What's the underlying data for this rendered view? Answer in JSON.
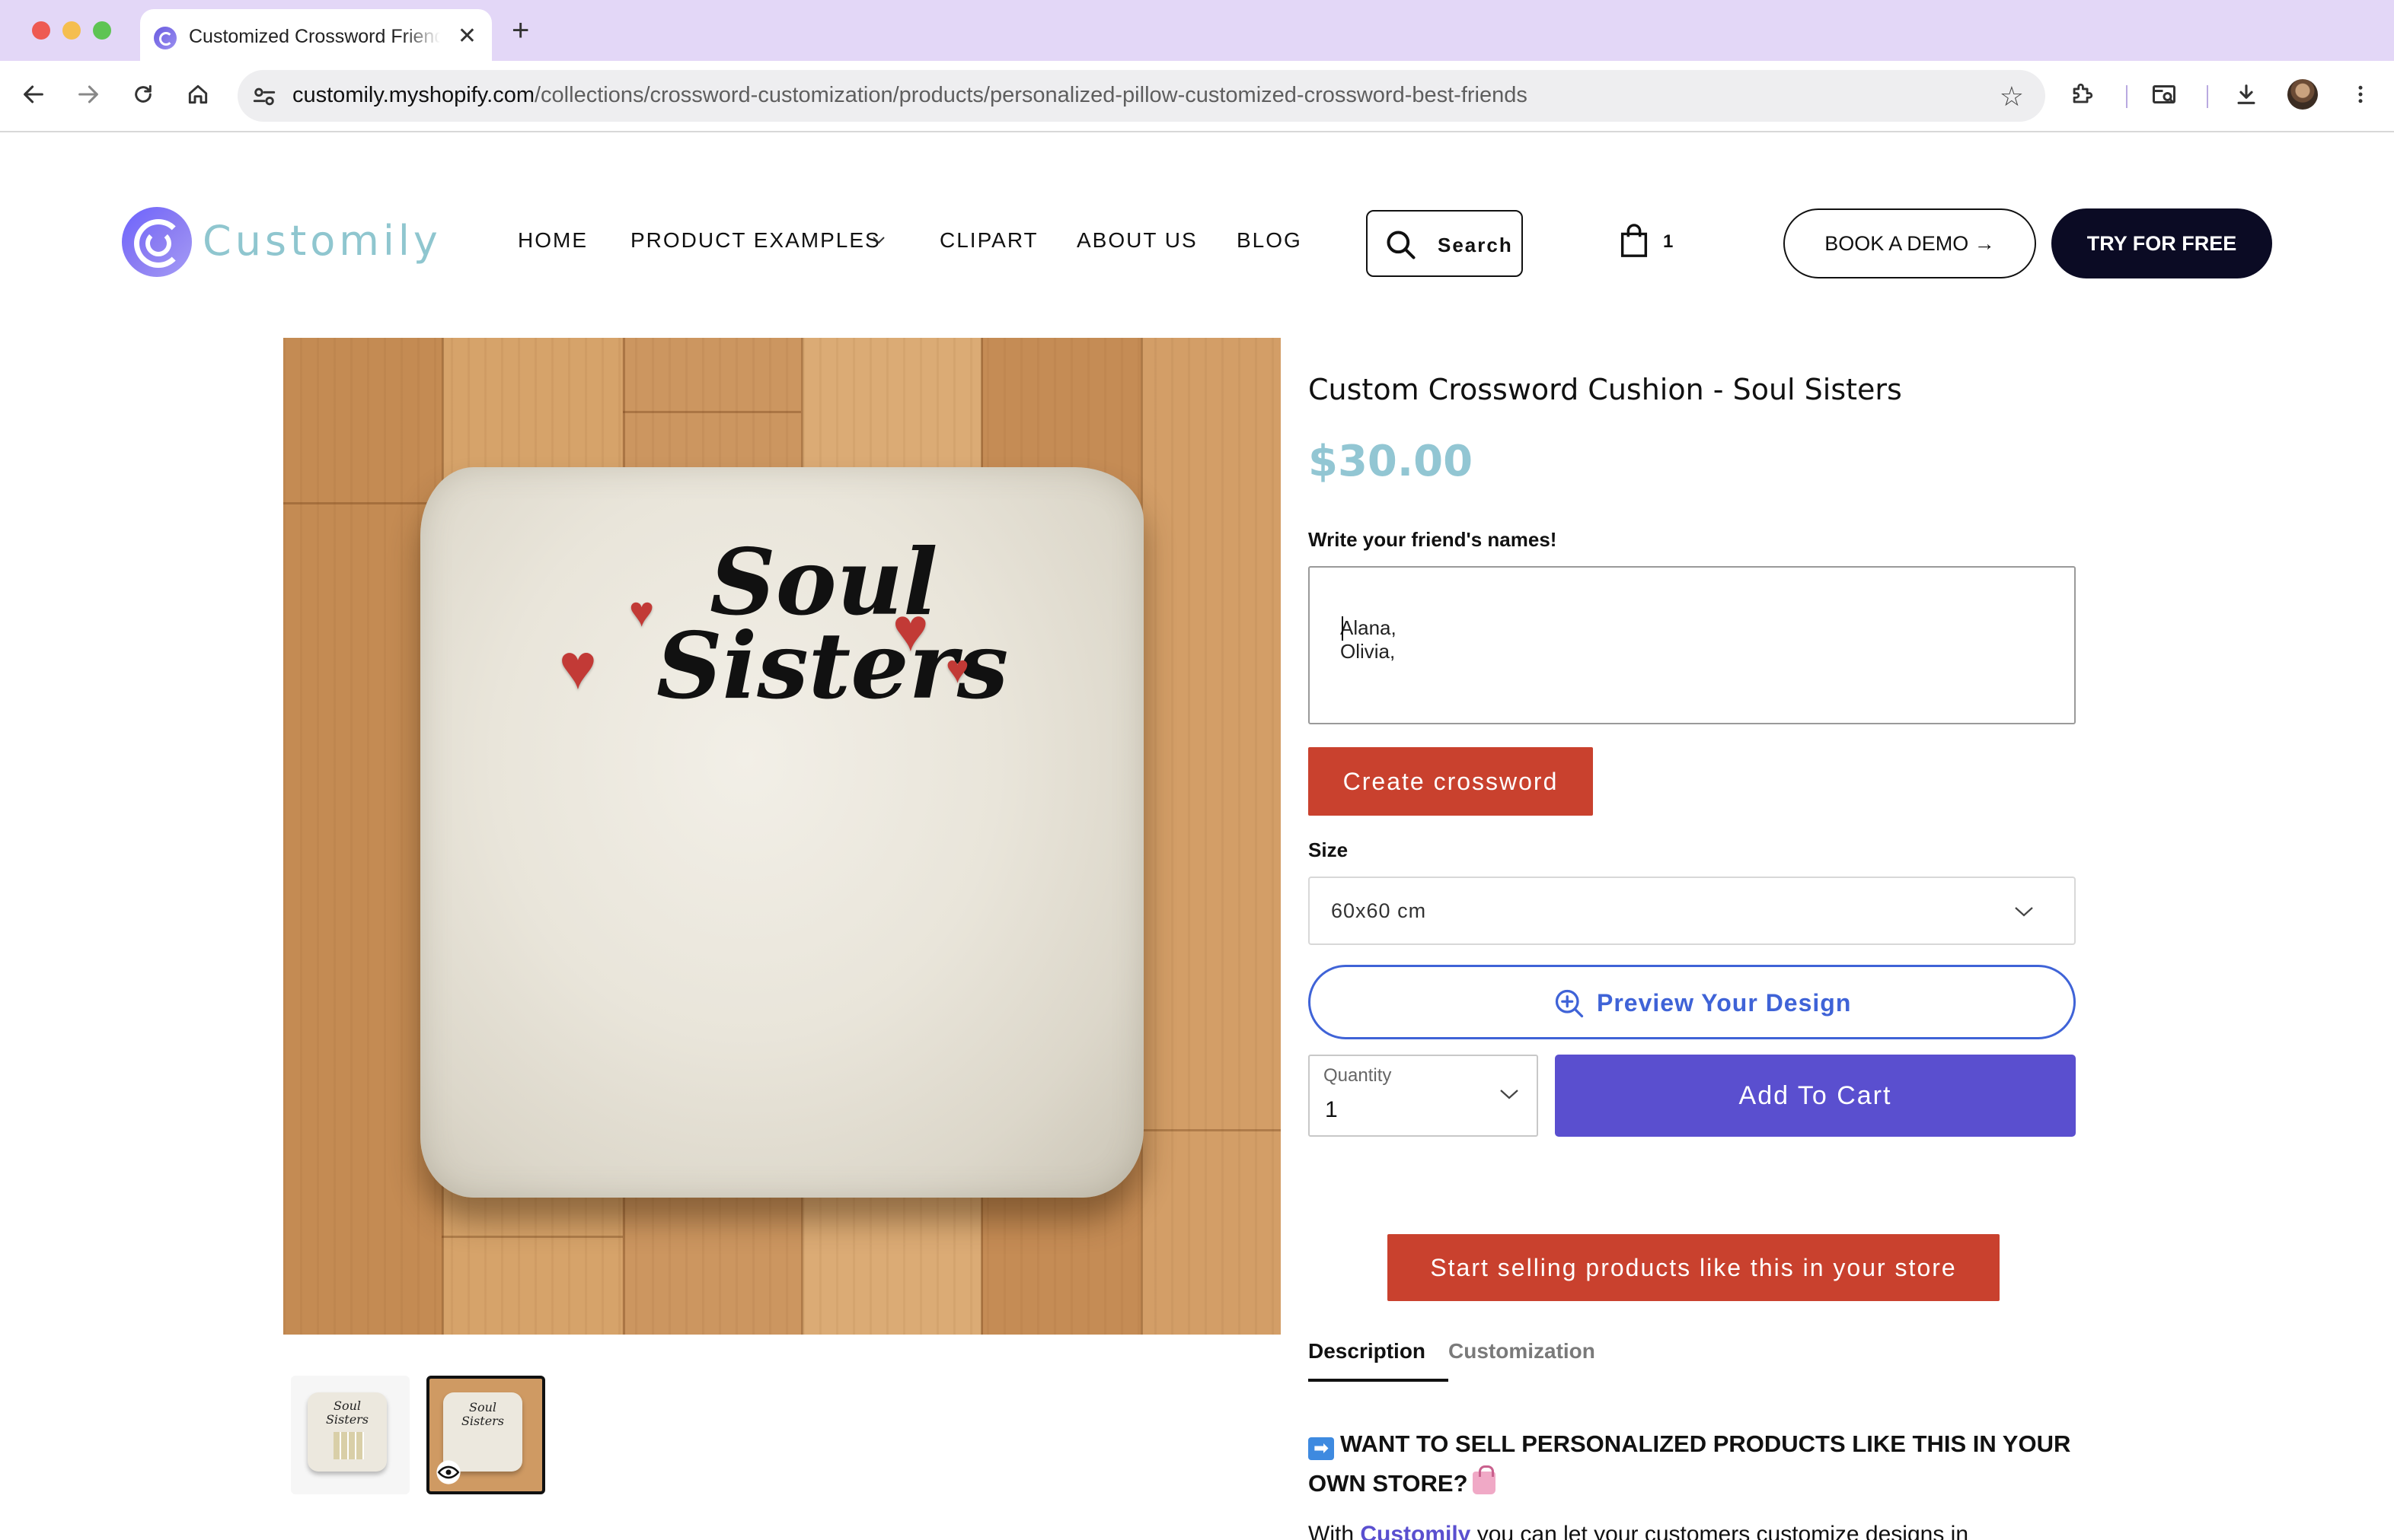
{
  "browser": {
    "tab_title": "Customized Crossword Friends",
    "url_host": "customily.myshopify.com",
    "url_path": "/collections/crossword-customization/products/personalized-pillow-customized-crossword-best-friends"
  },
  "header": {
    "logo_text": "Customily",
    "nav": [
      "HOME",
      "PRODUCT EXAMPLES",
      "CLIPART",
      "ABOUT US",
      "BLOG"
    ],
    "search_label": "Search",
    "cart_count": "1",
    "book_demo_label": "BOOK A DEMO →",
    "try_free_label": "TRY FOR FREE"
  },
  "product": {
    "image_text_line1": "Soul",
    "image_text_line2": "Sisters",
    "title": "Custom Crossword Cushion - Soul Sisters",
    "price": "$30.00",
    "names_label": "Write your friend's names!",
    "names_value": "Alana, Olivia, ",
    "create_button": "Create crossword",
    "size_label": "Size",
    "size_value": "60x60 cm",
    "preview_button": "Preview Your Design",
    "quantity_label": "Quantity",
    "quantity_value": "1",
    "add_to_cart": "Add To Cart",
    "sell_button": "Start selling products like this in your store",
    "tabs": [
      "Description",
      "Customization"
    ],
    "description_heading": "WANT TO SELL PERSONALIZED PRODUCTS LIKE THIS IN YOUR OWN STORE?",
    "description_start": "With ",
    "description_link": "Customily",
    "description_rest": " you can let your customers customize designs in"
  },
  "icons": [
    "back-icon",
    "forward-icon",
    "reload-icon",
    "home-icon",
    "site-settings-icon",
    "bookmark-star-icon",
    "extensions-icon",
    "tab-search-icon",
    "download-icon",
    "menu-icon",
    "search-icon",
    "shopping-bag-icon",
    "zoom-in-icon",
    "eye-icon"
  ],
  "colors": {
    "brand_teal": "#8fc6cf",
    "cta_red": "#c9412e",
    "cart_purple": "#5a4fcf",
    "preview_blue": "#3f63d7",
    "dark_navy": "#0b0b24"
  }
}
